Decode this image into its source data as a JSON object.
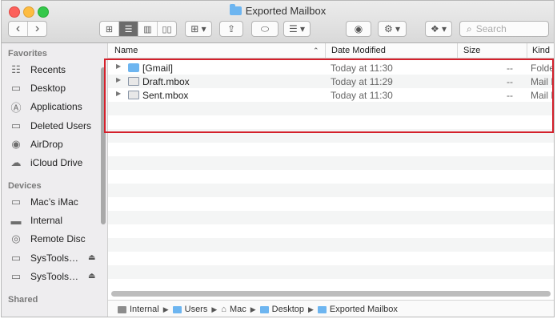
{
  "window": {
    "title": "Exported Mailbox"
  },
  "toolbar": {
    "back_icon": "‹",
    "forward_icon": "›",
    "view_icons": [
      "⊞",
      "☰",
      "▥",
      "▯▯"
    ],
    "group_icon": "⊞ ▾",
    "share_icon": "⇪",
    "tag_icon": "⬭",
    "arrange_icon": "☰ ▾",
    "quicklook_icon": "◉",
    "action_icon": "⚙ ▾",
    "dropbox_icon": "❖ ▾",
    "search_placeholder": "Search"
  },
  "sidebar": {
    "favorites_label": "Favorites",
    "favorites": [
      {
        "label": "Recents",
        "icon": "recents-icon",
        "glyph": "☷"
      },
      {
        "label": "Desktop",
        "icon": "desktop-icon",
        "glyph": "▭"
      },
      {
        "label": "Applications",
        "icon": "applications-icon",
        "glyph": "Ⓐ"
      },
      {
        "label": "Deleted Users",
        "icon": "folder-icon",
        "glyph": "▭"
      },
      {
        "label": "AirDrop",
        "icon": "airdrop-icon",
        "glyph": "◉"
      },
      {
        "label": "iCloud Drive",
        "icon": "cloud-icon",
        "glyph": "☁"
      }
    ],
    "devices_label": "Devices",
    "devices": [
      {
        "label": "Mac’s iMac",
        "icon": "imac-icon",
        "glyph": "▭"
      },
      {
        "label": "Internal",
        "icon": "disk-icon",
        "glyph": "▬"
      },
      {
        "label": "Remote Disc",
        "icon": "disc-icon",
        "glyph": "◎"
      },
      {
        "label": "SysTools…",
        "icon": "drive-icon",
        "glyph": "▭",
        "eject": "⏏"
      },
      {
        "label": "SysTools…",
        "icon": "drive-icon",
        "glyph": "▭",
        "eject": "⏏"
      }
    ],
    "shared_label": "Shared"
  },
  "columns": {
    "name": "Name",
    "date": "Date Modified",
    "size": "Size",
    "kind": "Kind"
  },
  "files": [
    {
      "name": "[Gmail]",
      "date": "Today at 11:30",
      "size": "--",
      "kind": "Folder",
      "type": "folder"
    },
    {
      "name": "Draft.mbox",
      "date": "Today at 11:29",
      "size": "--",
      "kind": "Mail Mailbox",
      "type": "mbox"
    },
    {
      "name": "Sent.mbox",
      "date": "Today at 11:30",
      "size": "--",
      "kind": "Mail Mailbox",
      "type": "mbox"
    }
  ],
  "path": [
    "Internal",
    "Users",
    "Mac",
    "Desktop",
    "Exported Mailbox"
  ],
  "colors": {
    "highlight": "#d4202b",
    "folder": "#6db5f0"
  }
}
